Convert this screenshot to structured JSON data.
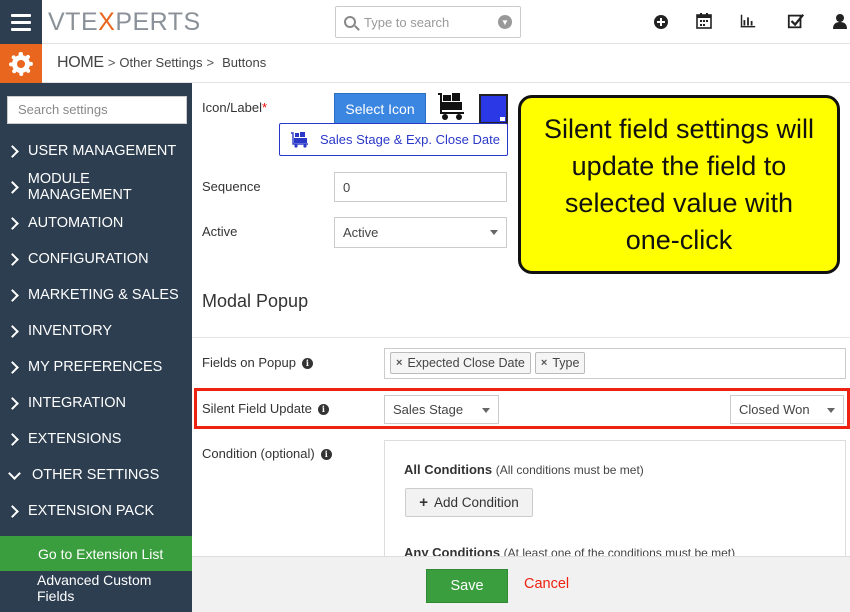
{
  "app": {
    "logo_vt": "VTE",
    "logo_x": "X",
    "logo_rest": "PERTS"
  },
  "topbar": {
    "search_placeholder": "Type to search",
    "icons": [
      "plus-circle-icon",
      "calendar-icon",
      "bar-chart-icon",
      "checkbox-icon",
      "user-icon"
    ]
  },
  "breadcrumb": {
    "home": "HOME",
    "sep": ">",
    "items": [
      "Other Settings",
      "Buttons"
    ]
  },
  "sidebar": {
    "search_placeholder": "Search settings",
    "items": [
      "USER MANAGEMENT",
      "MODULE MANAGEMENT",
      "AUTOMATION",
      "CONFIGURATION",
      "MARKETING & SALES",
      "INVENTORY",
      "MY PREFERENCES",
      "INTEGRATION",
      "EXTENSIONS",
      "OTHER SETTINGS",
      "EXTENSION PACK"
    ],
    "active_item": "Go to Extension List",
    "sub_item": "Advanced Custom Fields"
  },
  "form": {
    "icon_label": "Icon/Label",
    "required_mark": "*",
    "select_icon_label": "Select Icon",
    "preview_button_label": "Sales Stage & Exp. Close Date",
    "swatch_color": "#2a38e6",
    "sequence_label": "Sequence",
    "sequence_value": "0",
    "active_label": "Active",
    "active_value": "Active",
    "modal_title": "Modal Popup",
    "fields_on_popup_label": "Fields on Popup",
    "popup_fields": [
      "Expected Close Date",
      "Type"
    ],
    "silent_field_label": "Silent Field Update",
    "silent_field_value": "Sales Stage",
    "silent_value_value": "Closed Won",
    "condition_label": "Condition (optional)",
    "all_conditions_title": "All Conditions",
    "all_conditions_sub": "(All conditions must be met)",
    "add_condition_label": "Add Condition",
    "any_conditions_title": "Any Conditions",
    "any_conditions_sub": "(At least one of the conditions must be met)"
  },
  "footer": {
    "save_label": "Save",
    "cancel_label": "Cancel"
  },
  "callout": {
    "text": "Silent field settings will update the field to selected value with one-click"
  },
  "colors": {
    "sidebar_bg": "#2d3e50",
    "accent_orange": "#e8661d",
    "primary_blue": "#3b86e0",
    "success_green": "#3a9e3e",
    "highlight_red": "#ee2211",
    "callout_yellow": "#ffff00"
  }
}
